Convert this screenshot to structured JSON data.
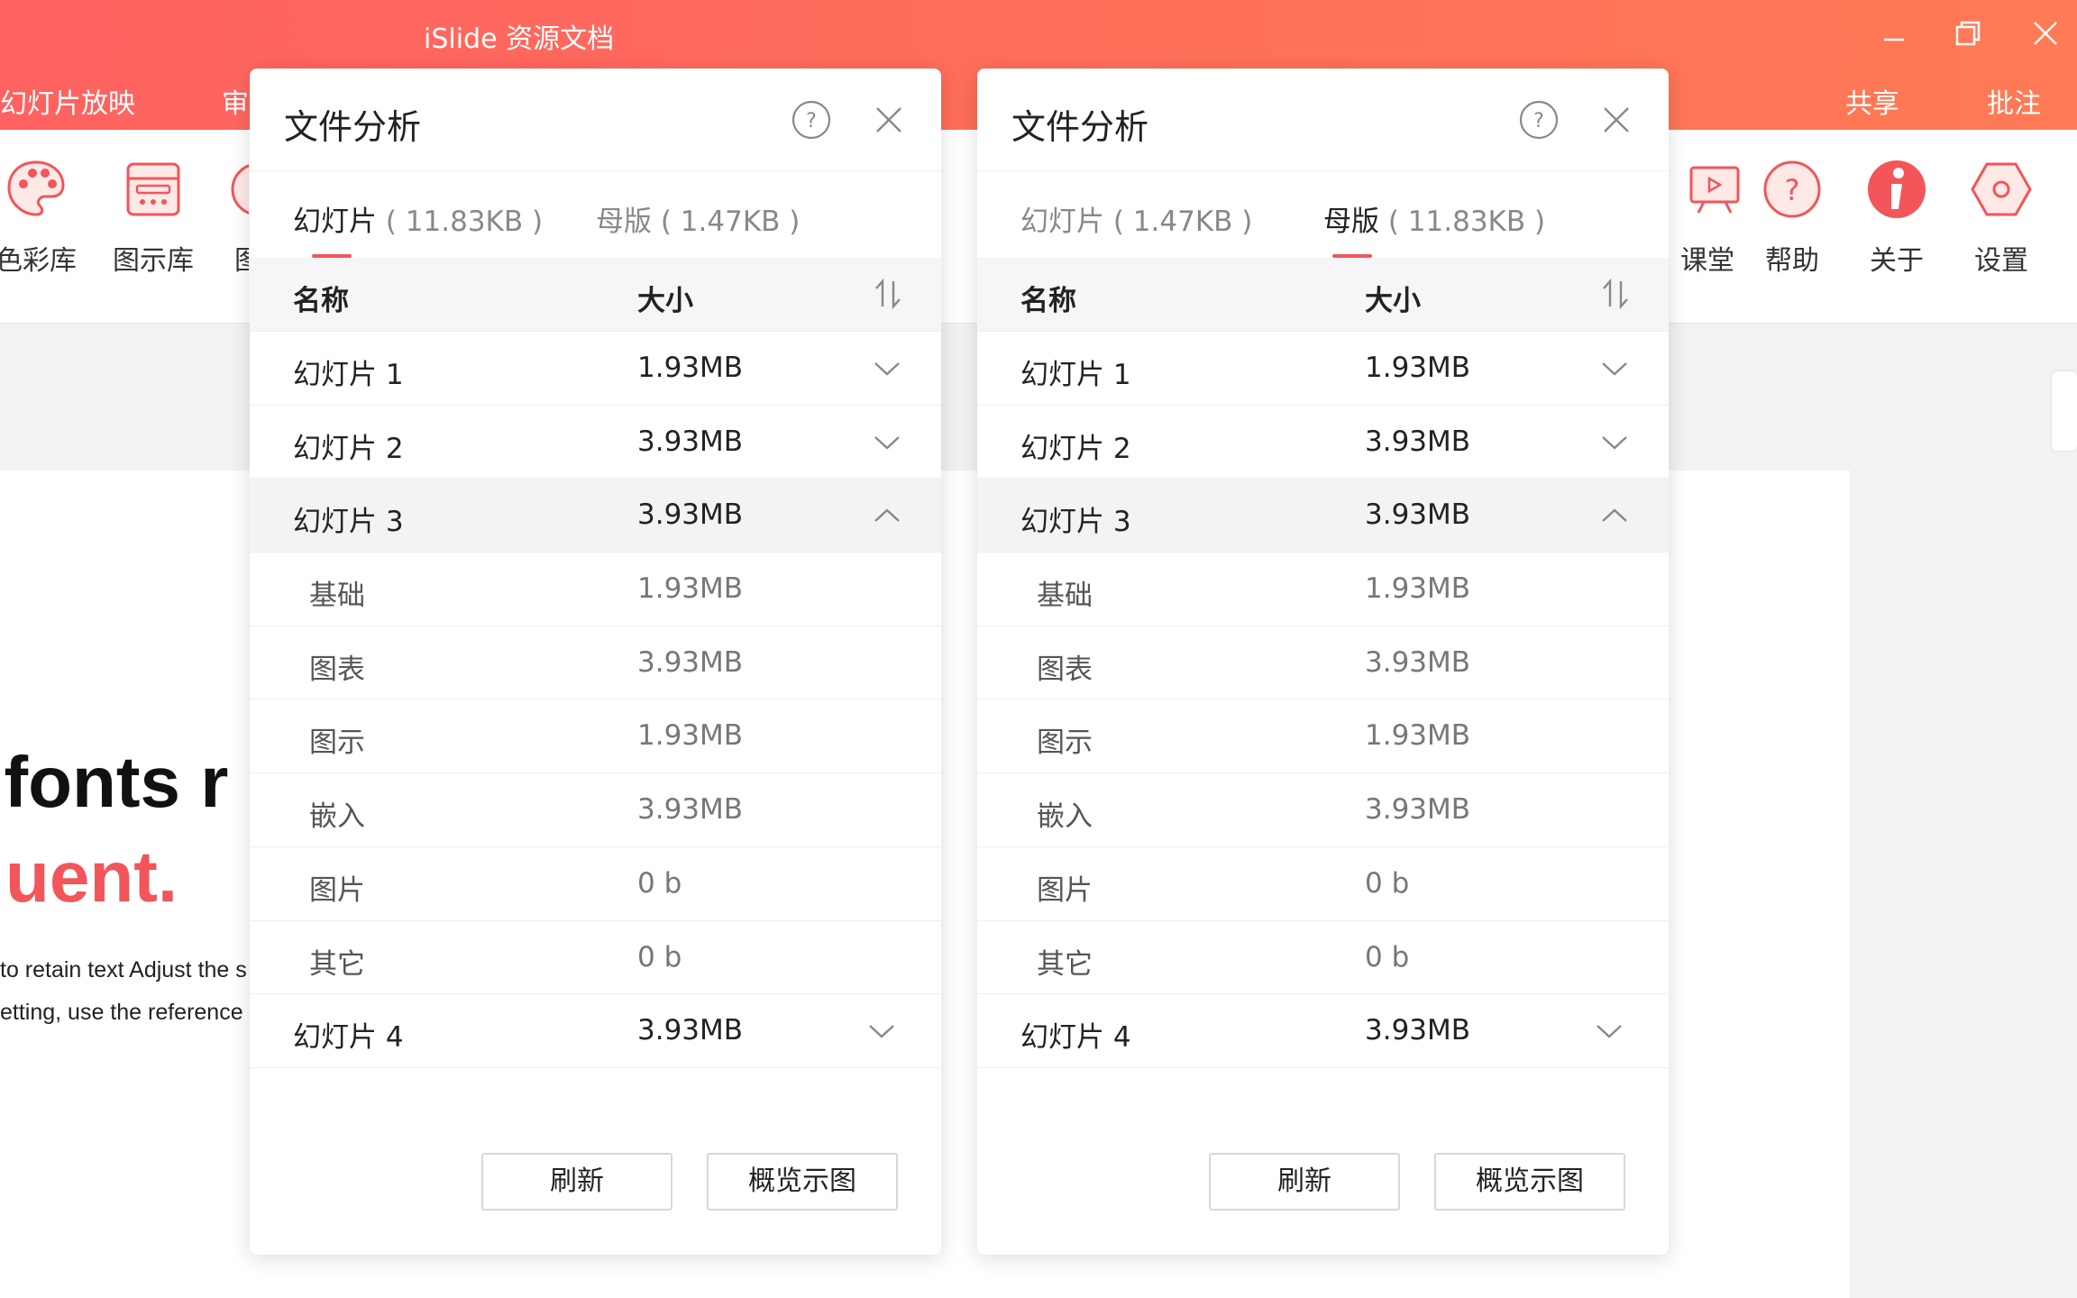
{
  "app": {
    "title": "iSlide 资源文档",
    "menu_tabs": {
      "slideshow": "幻灯片放映",
      "review": "审",
      "share": "共享",
      "annotate": "批注"
    },
    "colors": {
      "brand_start": "#ff6260",
      "brand_end": "#ff7a55",
      "accent": "#f2555a"
    }
  },
  "ribbon": {
    "left_items": [
      {
        "label": "色彩库",
        "icon": "palette-icon"
      },
      {
        "label": "图示库",
        "icon": "diagram-library-icon"
      },
      {
        "label": "图",
        "icon": "partial-icon"
      }
    ],
    "right_items": [
      {
        "label": "课堂",
        "icon": "classroom-icon"
      },
      {
        "label": "帮助",
        "icon": "help-icon"
      },
      {
        "label": "关于",
        "icon": "about-icon"
      },
      {
        "label": "设置",
        "icon": "settings-icon"
      }
    ]
  },
  "slide": {
    "headline": "l fonts r",
    "accent": "uent.",
    "body_line1": "to retain text Adjust the s",
    "body_line2": "etting, use the reference"
  },
  "dialogs": [
    {
      "title": "文件分析",
      "tabs": [
        {
          "name": "幻灯片",
          "size": "( 11.83KB )",
          "active": true
        },
        {
          "name": "母版",
          "size": "( 1.47KB )",
          "active": false
        }
      ],
      "columns": {
        "name": "名称",
        "size": "大小"
      },
      "rows": [
        {
          "name": "幻灯片 1",
          "size": "1.93MB"
        },
        {
          "name": "幻灯片 2",
          "size": "3.93MB"
        },
        {
          "name": "幻灯片 3",
          "size": "3.93MB"
        },
        {
          "name": "基础",
          "size": "1.93MB"
        },
        {
          "name": "图表",
          "size": "3.93MB"
        },
        {
          "name": "图示",
          "size": "1.93MB"
        },
        {
          "name": "嵌入",
          "size": "3.93MB"
        },
        {
          "name": "图片",
          "size": "0 b"
        },
        {
          "name": "其它",
          "size": "0 b"
        },
        {
          "name": "幻灯片 4",
          "size": "3.93MB"
        }
      ],
      "buttons": {
        "refresh": "刷新",
        "overview": "概览示图"
      }
    },
    {
      "title": "文件分析",
      "tabs": [
        {
          "name": "幻灯片",
          "size": "( 1.47KB )",
          "active": false
        },
        {
          "name": "母版",
          "size": "( 11.83KB )",
          "active": true
        }
      ],
      "columns": {
        "name": "名称",
        "size": "大小"
      },
      "rows": [
        {
          "name": "幻灯片 1",
          "size": "1.93MB"
        },
        {
          "name": "幻灯片 2",
          "size": "3.93MB"
        },
        {
          "name": "幻灯片 3",
          "size": "3.93MB"
        },
        {
          "name": "基础",
          "size": "1.93MB"
        },
        {
          "name": "图表",
          "size": "3.93MB"
        },
        {
          "name": "图示",
          "size": "1.93MB"
        },
        {
          "name": "嵌入",
          "size": "3.93MB"
        },
        {
          "name": "图片",
          "size": "0 b"
        },
        {
          "name": "其它",
          "size": "0 b"
        },
        {
          "name": "幻灯片 4",
          "size": "3.93MB"
        }
      ],
      "buttons": {
        "refresh": "刷新",
        "overview": "概览示图"
      }
    }
  ]
}
